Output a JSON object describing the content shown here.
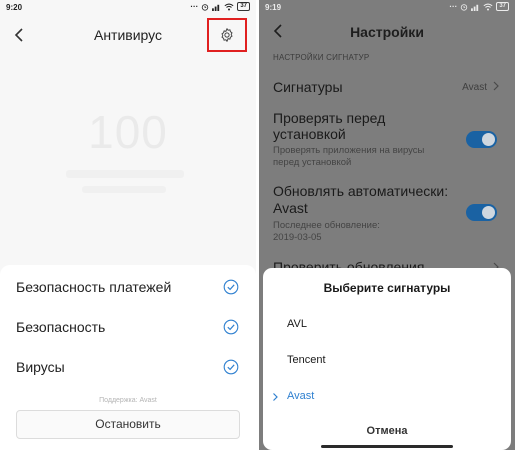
{
  "left": {
    "status_time": "9:20",
    "battery": "37",
    "title": "Антивирус",
    "score": "100",
    "items": [
      {
        "label": "Безопасность платежей"
      },
      {
        "label": "Безопасность"
      },
      {
        "label": "Вирусы"
      }
    ],
    "support": "Поддержка: Avast",
    "stop_label": "Остановить",
    "accent_color": "#2f80d0",
    "highlight_color": "#e02020"
  },
  "right": {
    "status_time": "9:19",
    "battery": "37",
    "title": "Настройки",
    "section": "НАСТРОЙКИ СИГНАТУР",
    "signatures": {
      "label": "Сигнатуры",
      "value": "Avast"
    },
    "check_before_install": {
      "label_l1": "Проверять перед",
      "label_l2": "установкой",
      "sub_l1": "Проверять приложения на вирусы",
      "sub_l2": "перед установкой",
      "enabled": true
    },
    "auto_update": {
      "label_l1": "Обновлять автоматически:",
      "label_l2": "Avast",
      "sub_l1": "Последнее обновление:",
      "sub_l2": "2019-03-05",
      "enabled": true
    },
    "partial_row": "Проверить обновления",
    "sheet": {
      "title": "Выберите сигнатуры",
      "options": [
        "AVL",
        "Tencent",
        "Avast"
      ],
      "selected": "Avast",
      "cancel": "Отмена"
    },
    "toggle_color": "#1a62a3"
  }
}
